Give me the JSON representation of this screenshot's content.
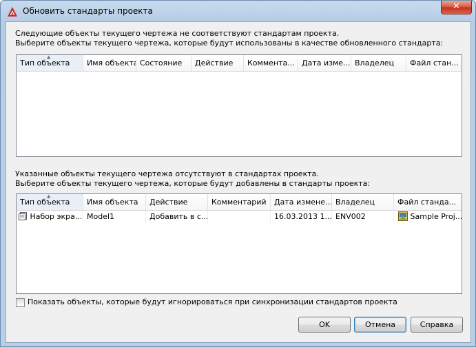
{
  "window": {
    "title": "Обновить стандарты проекта",
    "close_glyph": "✕",
    "accent": "#c1301a"
  },
  "top_section": {
    "line1": "Следующие объекты текущего чертежа не соответствуют стандартам проекта.",
    "line2": "Выберите объекты текущего чертежа, которые будут использованы в качестве обновленного стандарта:",
    "columns": [
      "Тип объекта",
      "Имя объекта",
      "Состояние",
      "Действие",
      "Коммента...",
      "Дата изме...",
      "Владелец",
      "Файл стан..."
    ]
  },
  "bottom_section": {
    "line1": "Указанные объекты текущего чертежа отсутствуют в стандартах проекта.",
    "line2": "Выберите объекты текущего чертежа, которые будут добавлены в стандарты проекта:",
    "columns": [
      "Тип объекта",
      "Имя объекта",
      "Действие",
      "Комментарий",
      "Дата измене...",
      "Владелец",
      "Файл станда..."
    ],
    "rows": [
      {
        "type": "Набор экра...",
        "name": "Model1",
        "action": "Добавить в с...",
        "comment": "",
        "date": "16.03.2013 1...",
        "owner": "ENV002",
        "file": "Sample Proj..."
      }
    ]
  },
  "show_ignored_checkbox": {
    "label": "Показать объекты, которые будут игнорироваться при синхронизации стандартов проекта",
    "checked": false
  },
  "buttons": {
    "ok": "OK",
    "cancel": "Отмена",
    "help": "Справка"
  }
}
